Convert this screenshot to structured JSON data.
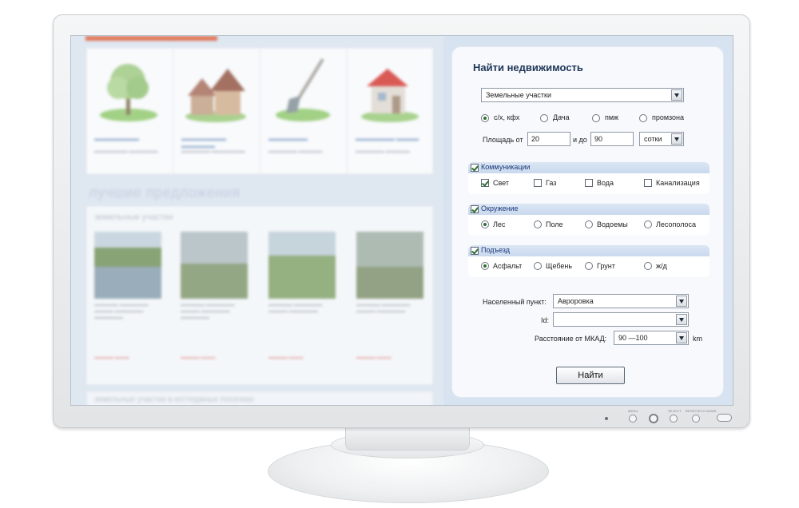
{
  "search": {
    "title": "Найти недвижимость",
    "property_type": "Земельные участки",
    "land_use": [
      {
        "label": "с/х, кфх",
        "selected": true
      },
      {
        "label": "Дача",
        "selected": false
      },
      {
        "label": "пмж",
        "selected": false
      },
      {
        "label": "промзона",
        "selected": false
      }
    ],
    "area": {
      "from_label": "Площадь от",
      "from_value": "20",
      "to_label": "и до",
      "to_value": "90",
      "unit": "сотки"
    },
    "communications": {
      "title": "Коммуникации",
      "enabled": true,
      "options": [
        {
          "label": "Свет",
          "checked": true
        },
        {
          "label": "Газ",
          "checked": false
        },
        {
          "label": "Вода",
          "checked": false
        },
        {
          "label": "Канализация",
          "checked": false
        }
      ]
    },
    "surroundings": {
      "title": "Окружение",
      "enabled": true,
      "options": [
        {
          "label": "Лес",
          "selected": true
        },
        {
          "label": "Поле",
          "selected": false
        },
        {
          "label": "Водоемы",
          "selected": false
        },
        {
          "label": "Лесополоса",
          "selected": false
        }
      ]
    },
    "access": {
      "title": "Подъезд",
      "enabled": true,
      "options": [
        {
          "label": "Асфальт",
          "selected": true
        },
        {
          "label": "Щебень",
          "selected": false
        },
        {
          "label": "Грунт",
          "selected": false
        },
        {
          "label": "ж/д",
          "selected": false
        }
      ]
    },
    "settlement": {
      "label": "Населенный пункт:",
      "value": "Авроровка"
    },
    "id_field": {
      "label": "Id:",
      "value": ""
    },
    "distance": {
      "label": "Расстояние от МКАД:",
      "value": "90 —100",
      "unit": "km"
    },
    "submit_label": "Найти"
  },
  "background_site": {
    "best_offers_title": "лучшие предложения",
    "section_land": "земельные участки",
    "section_cottage": "земельные участки в коттеджных поселках"
  },
  "monitor": {
    "buttons": [
      "MENU",
      "SELECT",
      "RESET/ECO MODE"
    ]
  },
  "colors": {
    "accent_orange": "#e26d4b",
    "title_blue": "#1f3658",
    "group_header": "#c9d9ee",
    "panel_bg": "#d7e3f1"
  }
}
